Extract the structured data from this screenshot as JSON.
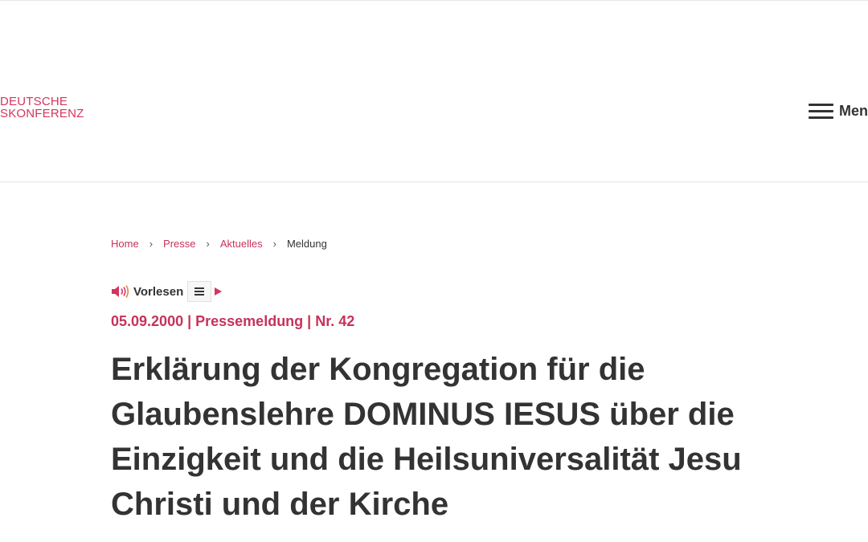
{
  "header": {
    "logo": {
      "line1": "DEUTSCHE",
      "line2": "SKONFERENZ",
      "color": "#d4345e"
    },
    "menu": {
      "label": "Men",
      "icon": "hamburger-icon"
    }
  },
  "breadcrumb": {
    "items": [
      {
        "label": "Home"
      },
      {
        "label": "Presse"
      },
      {
        "label": "Aktuelles"
      }
    ],
    "current": "Meldung",
    "separator": "›",
    "link_color": "#c8325a"
  },
  "readspeaker": {
    "label": "Vorlesen",
    "icons": [
      "speaker-icon",
      "menu-icon",
      "play-icon"
    ]
  },
  "article": {
    "meta": "05.09.2000 | Pressemeldung | Nr. 42",
    "title": "Erklärung der Kongregation für die Glaubenslehre DOMINUS IESUS über die Einzigkeit und die Heilsuniversalität Jesu Christi und der Kirche"
  },
  "colors": {
    "accent": "#c8325a",
    "text": "#333333"
  }
}
